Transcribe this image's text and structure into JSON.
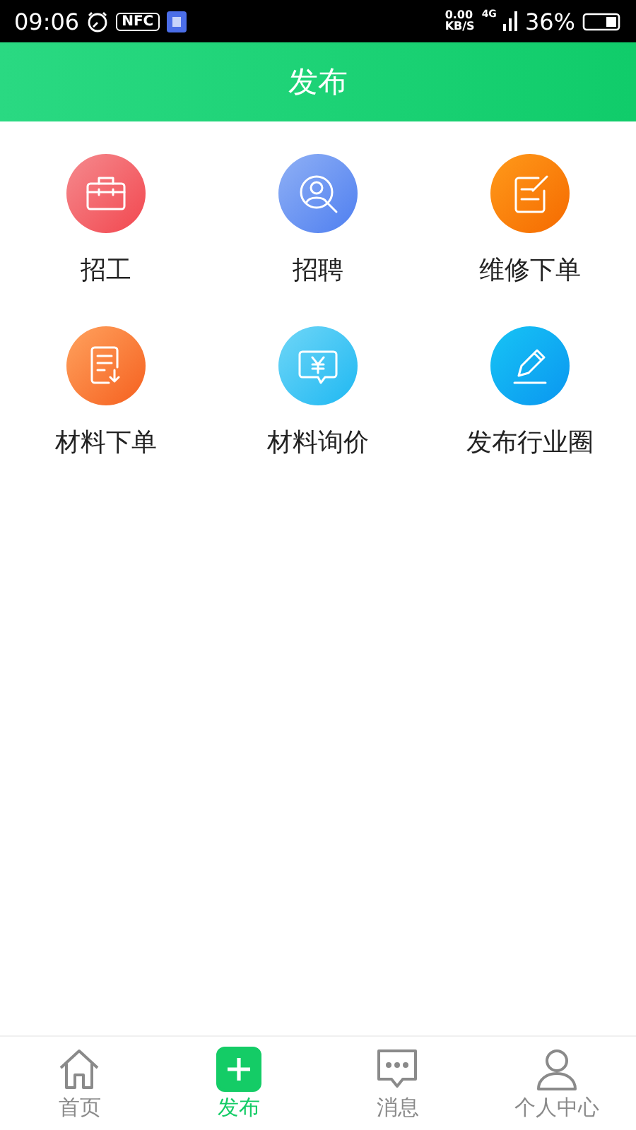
{
  "status_bar": {
    "time": "09:06",
    "nfc": "NFC",
    "speed_value": "0.00",
    "speed_unit": "KB/S",
    "network": "4G",
    "battery": "36%"
  },
  "header": {
    "title": "发布"
  },
  "items": [
    {
      "label": "招工",
      "kind": "briefcase"
    },
    {
      "label": "招聘",
      "kind": "person-search"
    },
    {
      "label": "维修下单",
      "kind": "note-edit"
    },
    {
      "label": "材料下单",
      "kind": "document-download"
    },
    {
      "label": "材料询价",
      "kind": "price-chat"
    },
    {
      "label": "发布行业圈",
      "kind": "pencil"
    }
  ],
  "tabs": [
    {
      "label": "首页",
      "kind": "home",
      "selected": false
    },
    {
      "label": "发布",
      "kind": "plus",
      "selected": true
    },
    {
      "label": "消息",
      "kind": "chat",
      "selected": false
    },
    {
      "label": "个人中心",
      "kind": "person",
      "selected": false
    }
  ]
}
